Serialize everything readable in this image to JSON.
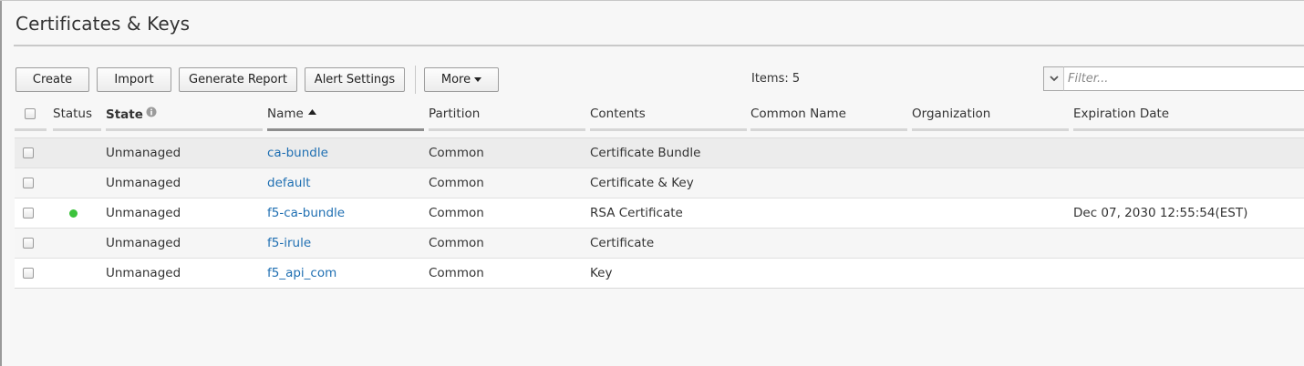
{
  "page": {
    "title": "Certificates & Keys"
  },
  "toolbar": {
    "create_label": "Create",
    "import_label": "Import",
    "generate_report_label": "Generate Report",
    "alert_settings_label": "Alert Settings",
    "more_label": "More",
    "items_count": "Items: 5"
  },
  "filter": {
    "placeholder": "Filter..."
  },
  "table": {
    "columns": {
      "status": "Status",
      "state": "State",
      "name": "Name",
      "partition": "Partition",
      "contents": "Contents",
      "common_name": "Common Name",
      "organization": "Organization",
      "expiration_date": "Expiration Date"
    },
    "rows": [
      {
        "state": "Unmanaged",
        "name": "ca-bundle",
        "partition": "Common",
        "contents": "Certificate Bundle",
        "common_name": "",
        "organization": "",
        "expiration_date": ""
      },
      {
        "state": "Unmanaged",
        "name": "default",
        "partition": "Common",
        "contents": "Certificate & Key",
        "common_name": "",
        "organization": "",
        "expiration_date": ""
      },
      {
        "state": "Unmanaged",
        "name": "f5-ca-bundle",
        "partition": "Common",
        "contents": "RSA Certificate",
        "common_name": "",
        "organization": "",
        "expiration_date": "Dec 07, 2030 12:55:54(EST)"
      },
      {
        "state": "Unmanaged",
        "name": "f5-irule",
        "partition": "Common",
        "contents": "Certificate",
        "common_name": "",
        "organization": "",
        "expiration_date": ""
      },
      {
        "state": "Unmanaged",
        "name": "f5_api_com",
        "partition": "Common",
        "contents": "Key",
        "common_name": "",
        "organization": "",
        "expiration_date": ""
      }
    ]
  },
  "colors": {
    "link": "#1f6fb2",
    "status_ok": "#3cc33c"
  },
  "icons": {
    "state_info": "info-icon",
    "sort": "sort-ascending-icon",
    "more_caret": "caret-down-icon",
    "filter_dropdown": "chevron-down-icon"
  }
}
